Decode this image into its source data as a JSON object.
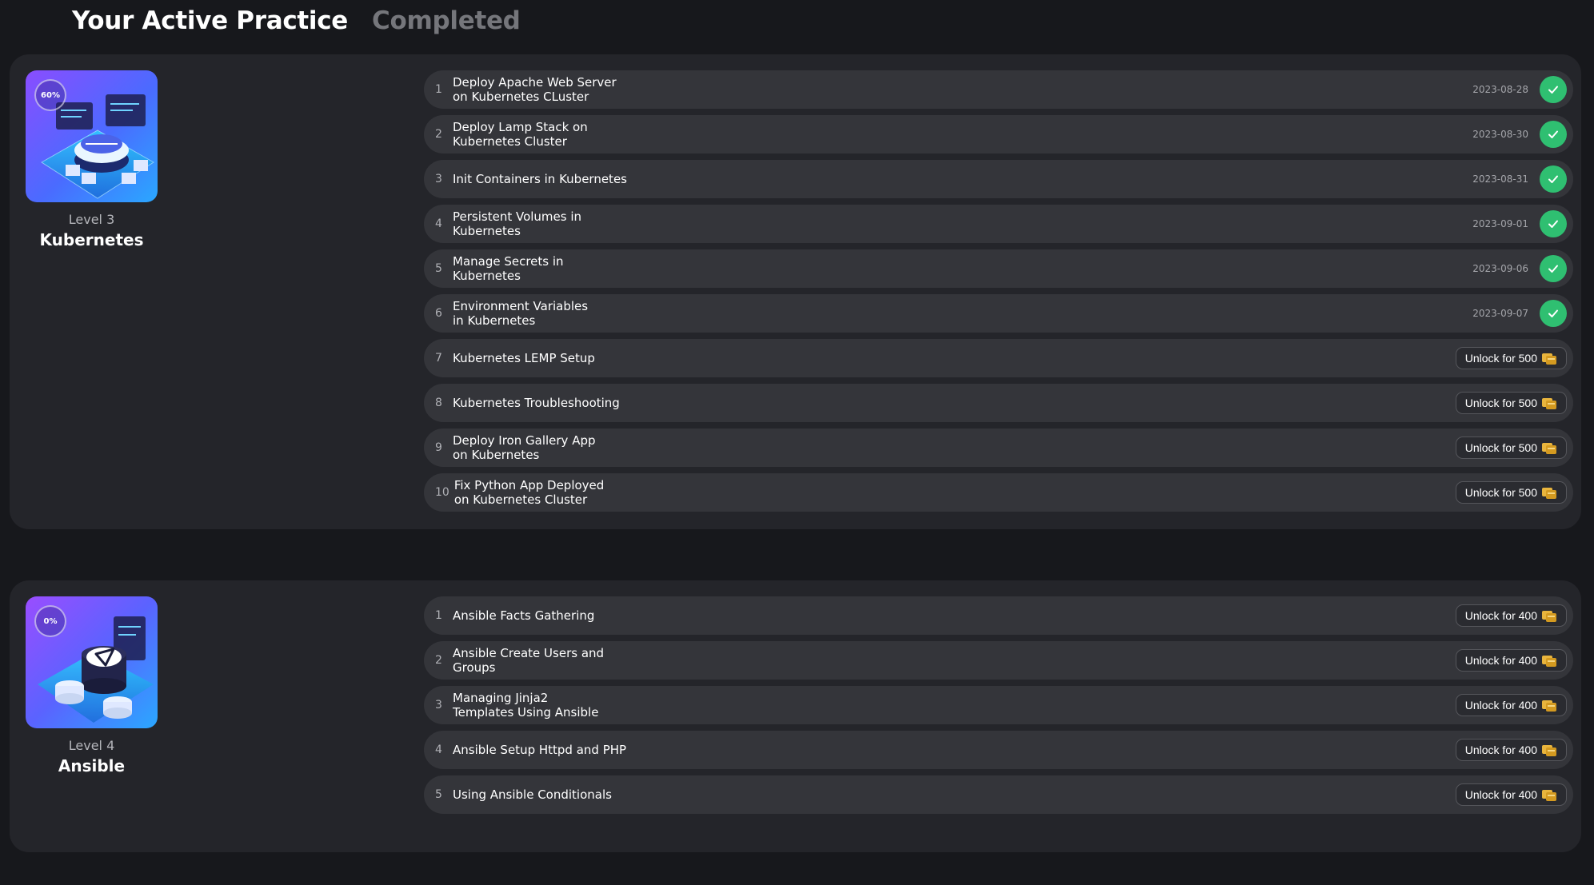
{
  "tabs": [
    {
      "label": "Your Active Practice",
      "active": true
    },
    {
      "label": "Completed",
      "active": false
    }
  ],
  "colors": {
    "background": "#17181c",
    "card": "#24252a",
    "row": "#34353a",
    "check": "#2fbf71",
    "coin": "#e9b53d"
  },
  "courses": [
    {
      "progress": "60%",
      "level": "Level 3",
      "name": "Kubernetes",
      "thumbnail_icon": "kubernetes-cluster-illustration",
      "lessons": [
        {
          "num": "1",
          "title": "Deploy Apache Web Server on Kubernetes CLuster",
          "date": "2023-08-28",
          "status": "completed"
        },
        {
          "num": "2",
          "title": "Deploy Lamp Stack on Kubernetes Cluster",
          "date": "2023-08-30",
          "status": "completed"
        },
        {
          "num": "3",
          "title": "Init Containers in Kubernetes",
          "date": "2023-08-31",
          "status": "completed"
        },
        {
          "num": "4",
          "title": "Persistent Volumes in Kubernetes",
          "date": "2023-09-01",
          "status": "completed"
        },
        {
          "num": "5",
          "title": "Manage Secrets in Kubernetes",
          "date": "2023-09-06",
          "status": "completed"
        },
        {
          "num": "6",
          "title": "Environment Variables in Kubernetes",
          "date": "2023-09-07",
          "status": "completed"
        },
        {
          "num": "7",
          "title": "Kubernetes LEMP Setup",
          "status": "locked",
          "unlock_label": "Unlock for 500"
        },
        {
          "num": "8",
          "title": "Kubernetes Troubleshooting",
          "status": "locked",
          "unlock_label": "Unlock for 500"
        },
        {
          "num": "9",
          "title": "Deploy Iron Gallery App on Kubernetes",
          "status": "locked",
          "unlock_label": "Unlock for 500"
        },
        {
          "num": "10",
          "title": "Fix Python App Deployed on Kubernetes Cluster",
          "status": "locked",
          "unlock_label": "Unlock for 500"
        }
      ]
    },
    {
      "progress": "0%",
      "level": "Level 4",
      "name": "Ansible",
      "thumbnail_icon": "ansible-database-illustration",
      "lessons": [
        {
          "num": "1",
          "title": "Ansible Facts Gathering",
          "status": "locked",
          "unlock_label": "Unlock for 400"
        },
        {
          "num": "2",
          "title": "Ansible Create Users and Groups",
          "status": "locked",
          "unlock_label": "Unlock for 400"
        },
        {
          "num": "3",
          "title": "Managing Jinja2 Templates Using Ansible",
          "status": "locked",
          "unlock_label": "Unlock for 400"
        },
        {
          "num": "4",
          "title": "Ansible Setup Httpd and PHP",
          "status": "locked",
          "unlock_label": "Unlock for 400"
        },
        {
          "num": "5",
          "title": "Using Ansible Conditionals",
          "status": "locked",
          "unlock_label": "Unlock for 400"
        }
      ]
    }
  ]
}
